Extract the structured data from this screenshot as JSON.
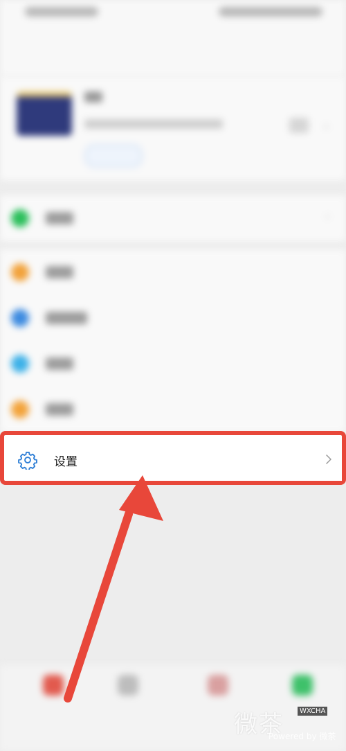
{
  "settings": {
    "label": "设置",
    "icon": "gear-icon",
    "highlight_color": "#e8473a",
    "icon_color": "#2f7fd6"
  },
  "annotation": {
    "arrow_color": "#e8473a"
  },
  "blurred_menu": {
    "row_icons": [
      "wallet-icon",
      "favorites-icon",
      "moments-icon",
      "cards-icon",
      "stickers-icon"
    ],
    "row_icon_colors": [
      "#2bbf5b",
      "#f2a23a",
      "#3d8be0",
      "#3db1e8",
      "#f3a33a"
    ]
  },
  "bottom_nav": {
    "icons": [
      "chats-icon",
      "contacts-icon",
      "discover-icon",
      "me-icon"
    ]
  },
  "watermark": {
    "main": "微茶",
    "badge": "WXCHA",
    "sub": "Powered by 微茶"
  }
}
